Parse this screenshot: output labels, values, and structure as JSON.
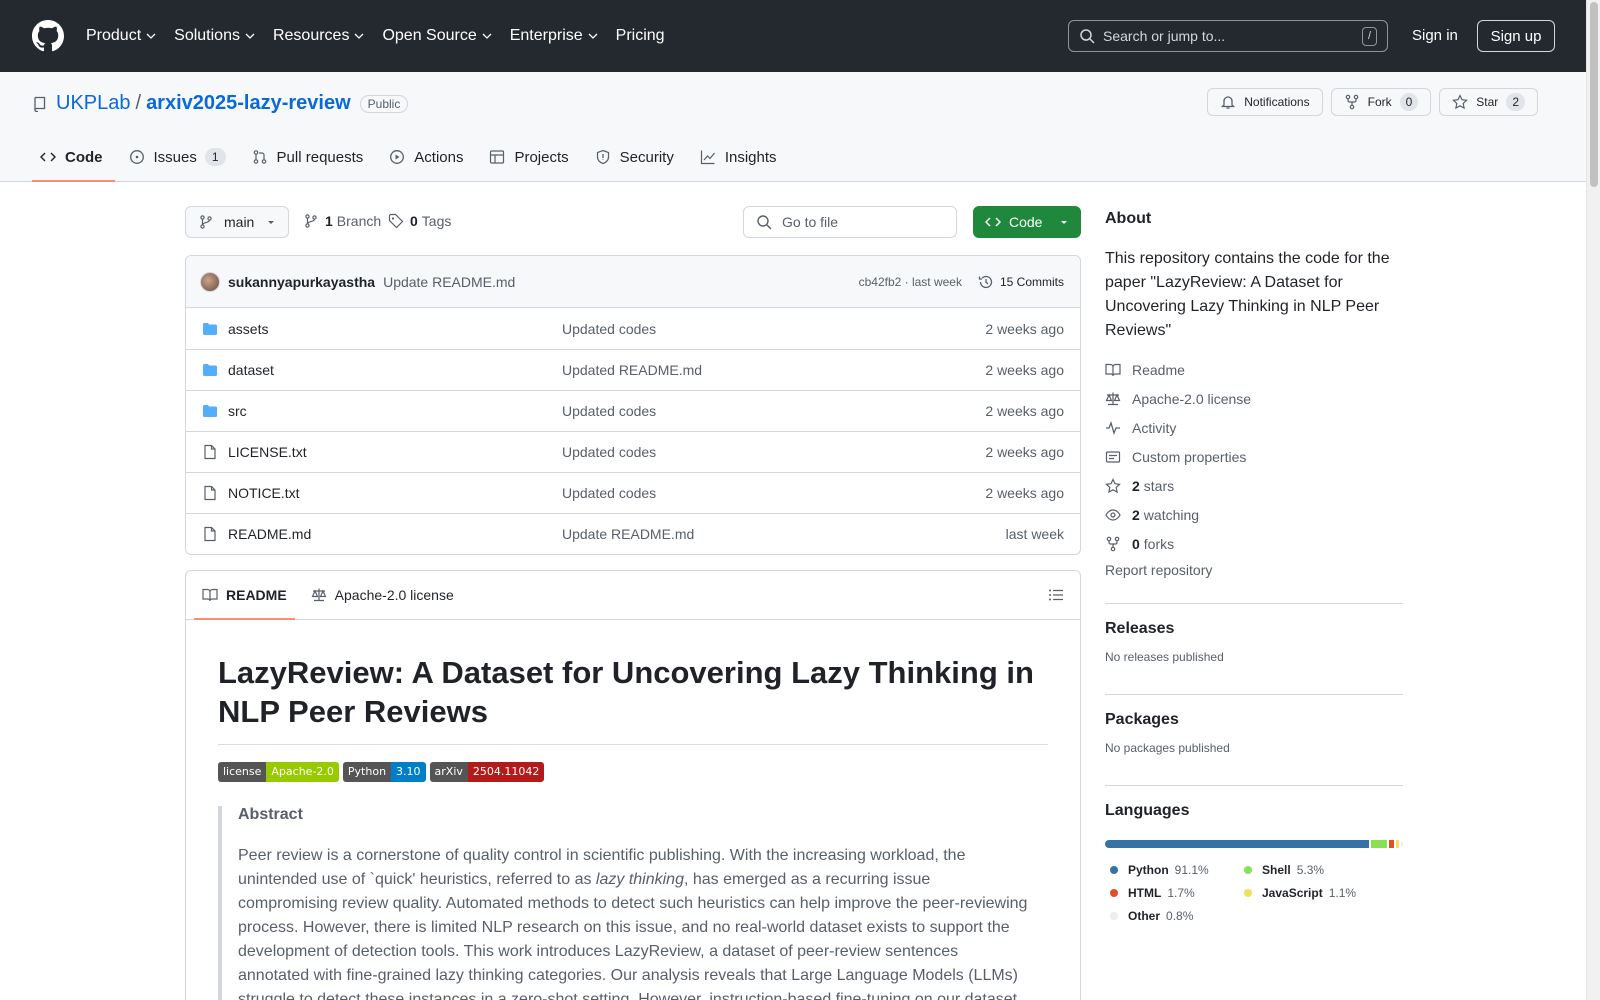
{
  "header": {
    "nav": [
      "Product",
      "Solutions",
      "Resources",
      "Open Source",
      "Enterprise",
      "Pricing"
    ],
    "search_placeholder": "Search or jump to...",
    "search_shortcut": "/",
    "signin": "Sign in",
    "signup": "Sign up"
  },
  "repo": {
    "owner": "UKPLab",
    "separator": "/",
    "name": "arxiv2025-lazy-review",
    "visibility": "Public",
    "notifications_label": "Notifications",
    "fork_label": "Fork",
    "fork_count": "0",
    "star_label": "Star",
    "star_count": "2"
  },
  "tabs": [
    {
      "label": "Code"
    },
    {
      "label": "Issues",
      "count": "1"
    },
    {
      "label": "Pull requests"
    },
    {
      "label": "Actions"
    },
    {
      "label": "Projects"
    },
    {
      "label": "Security"
    },
    {
      "label": "Insights"
    }
  ],
  "toolbar": {
    "branch": "main",
    "branch_count": "1",
    "branch_label": "Branch",
    "tag_count": "0",
    "tag_label": "Tags",
    "goto_placeholder": "Go to file",
    "code_label": "Code"
  },
  "commit": {
    "author": "sukannyapurkayastha",
    "message": "Update README.md",
    "hash_time": "cb42fb2 · last week",
    "commits_label": "15 Commits"
  },
  "files": [
    {
      "type": "folder",
      "name": "assets",
      "message": "Updated codes",
      "age": "2 weeks ago"
    },
    {
      "type": "folder",
      "name": "dataset",
      "message": "Updated README.md",
      "age": "2 weeks ago"
    },
    {
      "type": "folder",
      "name": "src",
      "message": "Updated codes",
      "age": "2 weeks ago"
    },
    {
      "type": "file",
      "name": "LICENSE.txt",
      "message": "Updated codes",
      "age": "2 weeks ago"
    },
    {
      "type": "file",
      "name": "NOTICE.txt",
      "message": "Updated codes",
      "age": "2 weeks ago"
    },
    {
      "type": "file",
      "name": "README.md",
      "message": "Update README.md",
      "age": "last week"
    }
  ],
  "readme": {
    "tab_readme": "README",
    "tab_license": "Apache-2.0 license",
    "title": "LazyReview: A Dataset for Uncovering Lazy Thinking in NLP Peer Reviews",
    "shields": [
      {
        "left": "license",
        "right": "Apache-2.0",
        "color": "#97ca00"
      },
      {
        "left": "Python",
        "right": "3.10",
        "color": "#007ec6"
      },
      {
        "left": "arXiv",
        "right": "2504.11042",
        "color": "#b31b1b"
      }
    ],
    "abstract_heading": "Abstract",
    "abstract_before": "Peer review is a cornerstone of quality control in scientific publishing. With the increasing workload, the unintended use of `quick' heuristics, referred to as ",
    "abstract_italic": "lazy thinking",
    "abstract_after": ", has emerged as a recurring issue compromising review quality. Automated methods to detect such heuristics can help improve the peer-reviewing process. However, there is limited NLP research on this issue, and no real-world dataset exists to support the development of detection tools. This work introduces LazyReview, a dataset of peer-review sentences annotated with fine-grained lazy thinking categories. Our analysis reveals that Large Language Models (LLMs) struggle to detect these instances in a zero-shot setting. However, instruction-based fine-tuning on our dataset"
  },
  "about": {
    "heading": "About",
    "description": "This repository contains the code for the paper \"LazyReview: A Dataset for Uncovering Lazy Thinking in NLP Peer Reviews\"",
    "readme": "Readme",
    "license": "Apache-2.0 license",
    "activity": "Activity",
    "custom_properties": "Custom properties",
    "stars_count": "2",
    "stars_label": "stars",
    "watching_count": "2",
    "watching_label": "watching",
    "forks_count": "0",
    "forks_label": "forks",
    "report": "Report repository"
  },
  "releases": {
    "heading": "Releases",
    "text": "No releases published"
  },
  "packages": {
    "heading": "Packages",
    "text": "No packages published"
  },
  "languages": {
    "heading": "Languages",
    "items": [
      {
        "name": "Python",
        "pct": "91.1%",
        "value": 91.1,
        "color": "#3572A5"
      },
      {
        "name": "Shell",
        "pct": "5.3%",
        "value": 5.3,
        "color": "#89e051"
      },
      {
        "name": "HTML",
        "pct": "1.7%",
        "value": 1.7,
        "color": "#e34c26"
      },
      {
        "name": "JavaScript",
        "pct": "1.1%",
        "value": 1.1,
        "color": "#f1e05a"
      },
      {
        "name": "Other",
        "pct": "0.8%",
        "value": 0.8,
        "color": "#ededed"
      }
    ]
  }
}
